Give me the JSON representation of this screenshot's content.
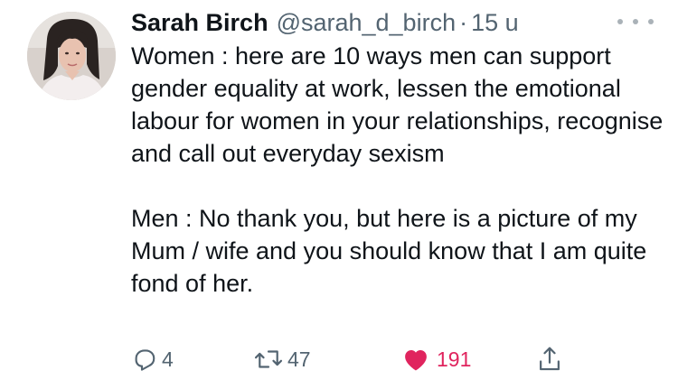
{
  "tweet": {
    "author": {
      "display_name": "Sarah Birch",
      "handle": "@sarah_d_birch",
      "avatar_icon": "profile-photo"
    },
    "separator": "·",
    "time": "15 u",
    "more_icon": "more-dots-icon",
    "text_paragraph_1": "Women : here are 10 ways men can support gender equality at work, lessen the emotional labour for women in your relationships, recognise and call out everyday sexism",
    "text_paragraph_2": "Men : No thank you, but here is a picture of my Mum / wife and you should know that I am quite fond of her.",
    "actions": {
      "reply_count": "4",
      "retweet_count": "47",
      "like_count": "191",
      "reply_icon": "reply-icon",
      "retweet_icon": "retweet-icon",
      "like_icon": "heart-icon",
      "share_icon": "share-icon"
    },
    "colors": {
      "text": "#0f1419",
      "secondary": "#536471",
      "like": "#e0245e"
    }
  }
}
